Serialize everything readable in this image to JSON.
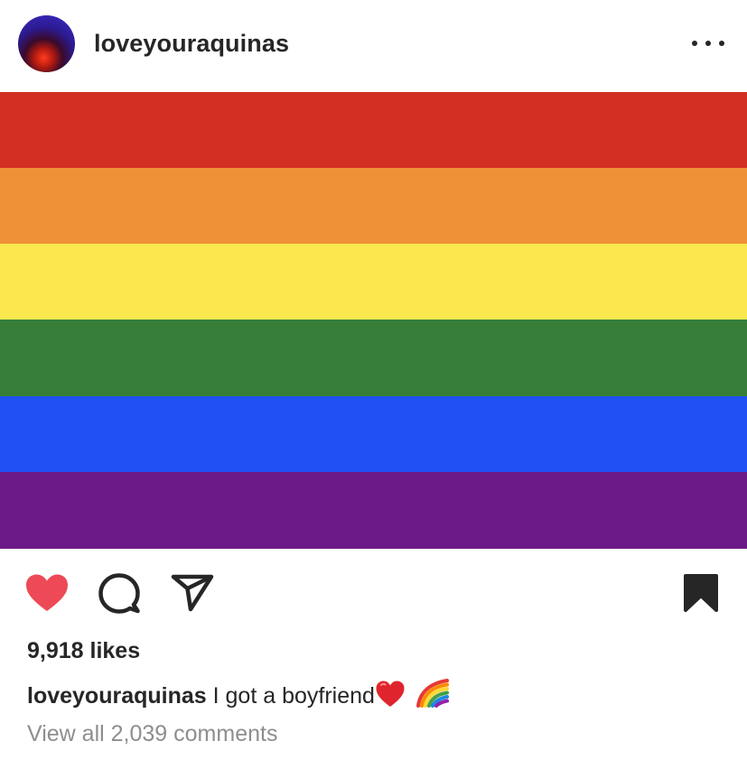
{
  "post": {
    "username": "loveyouraquinas",
    "more_label": "•••",
    "image": {
      "description": "",
      "stripes": [
        {
          "color": "#d32f23"
        },
        {
          "color": "#ef9136"
        },
        {
          "color": "#fbe84f"
        },
        {
          "color": "#367e38"
        },
        {
          "color": "#2151f5"
        },
        {
          "color": "#6b1a86"
        }
      ]
    },
    "actions": {
      "like_icon": "heart-filled-icon",
      "comment_icon": "comment-icon",
      "share_icon": "paper-plane-icon",
      "save_icon": "bookmark-filled-icon",
      "like_color": "#ed4956"
    },
    "likes": "9,918 likes",
    "caption": {
      "username": "loveyouraquinas",
      "text": "I got a boyfriend",
      "emojis": [
        "red-heart-emoji",
        "rainbow-emoji"
      ]
    },
    "view_comments": "View all 2,039 comments"
  }
}
